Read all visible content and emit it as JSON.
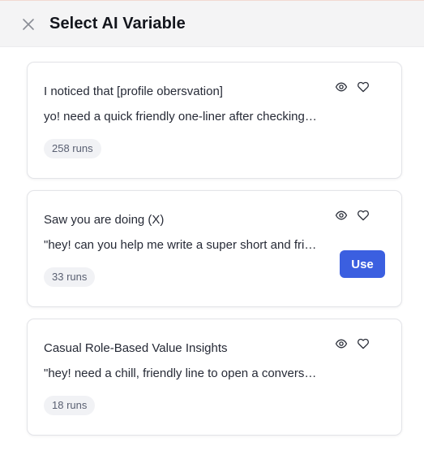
{
  "header": {
    "title": "Select AI Variable",
    "close_icon": "close-icon"
  },
  "cards": [
    {
      "title": "I noticed that [profile obersvation]",
      "description": "yo! need a quick friendly one-liner after checking out",
      "runs": "258 runs",
      "use_label": ""
    },
    {
      "title": "Saw you are doing (X)",
      "description": "\"hey! can you help me write a super short and friendly",
      "runs": "33 runs",
      "use_label": "Use"
    },
    {
      "title": "Casual Role-Based Value Insights",
      "description": "\"hey! need a chill, friendly line to open a conversation",
      "runs": "18 runs",
      "use_label": ""
    }
  ],
  "colors": {
    "accent": "#3b5fe0",
    "header_bg": "#f4f4f5",
    "badge_bg": "#f1f2f5"
  }
}
